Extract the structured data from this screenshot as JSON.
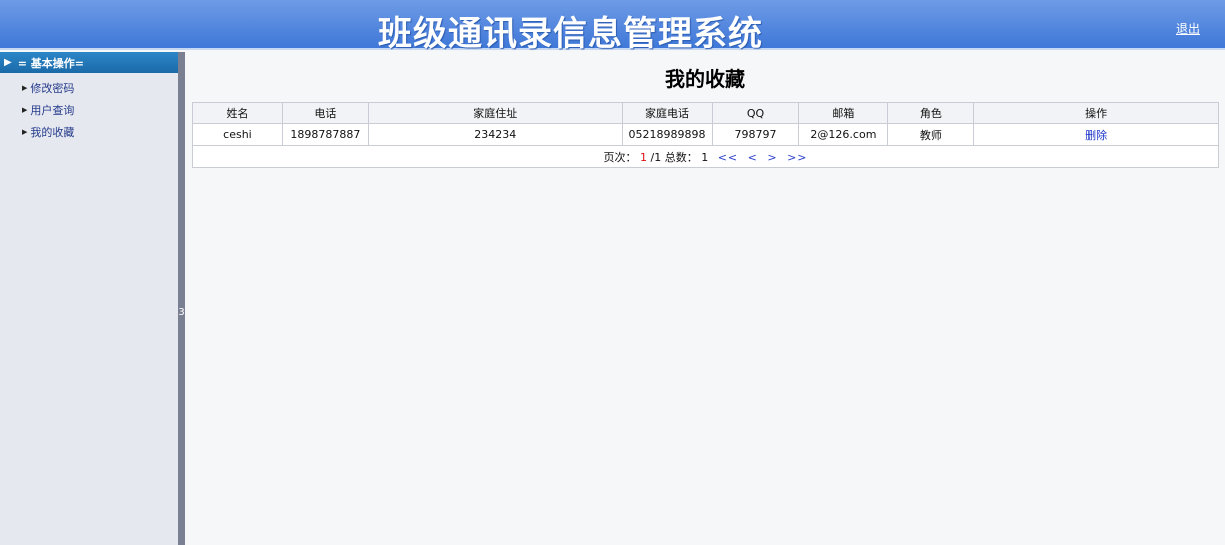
{
  "header": {
    "title": "班级通讯录信息管理系统",
    "logout": "退出"
  },
  "sidebar": {
    "section_title": "= 基本操作=",
    "items": [
      {
        "label": "修改密码"
      },
      {
        "label": "用户查询"
      },
      {
        "label": "我的收藏"
      }
    ],
    "splitter_mark": "3"
  },
  "main": {
    "title": "我的收藏",
    "columns": [
      "姓名",
      "电话",
      "家庭住址",
      "家庭电话",
      "QQ",
      "邮箱",
      "角色",
      "操作"
    ],
    "rows": [
      {
        "name": "ceshi",
        "phone": "1898787887",
        "address": "234234",
        "home_phone": "05218989898",
        "qq": "798797",
        "email": "2@126.com",
        "role": "教师",
        "action": "删除"
      }
    ],
    "pager": {
      "label": "页次：",
      "current": "1",
      "total_pages": "/1",
      "total_label": "总数：",
      "total": "1",
      "first": "<<",
      "prev": "<",
      "next": ">",
      "last": ">>"
    }
  }
}
